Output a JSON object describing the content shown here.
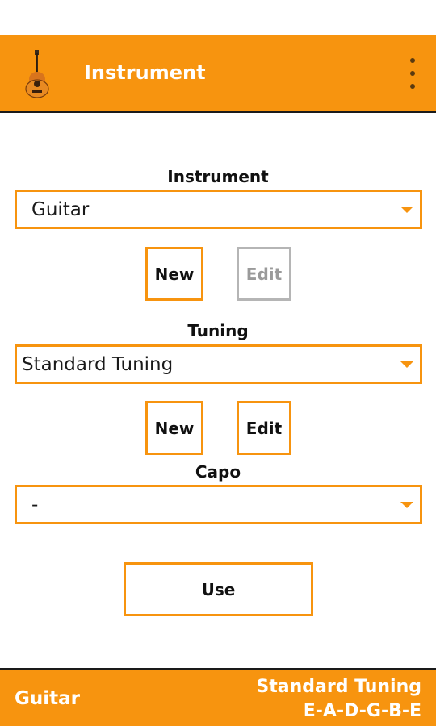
{
  "action_bar": {
    "title": "Instrument",
    "app_icon": "guitar-icon",
    "overflow_icon": "overflow-menu-icon"
  },
  "instrument_section": {
    "label": "Instrument",
    "selected": "Guitar",
    "new_label": "New",
    "edit_label": "Edit",
    "edit_enabled": false
  },
  "tuning_section": {
    "label": "Tuning",
    "selected": "Standard Tuning",
    "new_label": "New",
    "edit_label": "Edit",
    "edit_enabled": true
  },
  "capo_section": {
    "label": "Capo",
    "selected": "-"
  },
  "use_button_label": "Use",
  "bottom_bar": {
    "instrument": "Guitar",
    "tuning_name": "Standard Tuning",
    "tuning_notes": "E-A-D-G-B-E"
  },
  "colors": {
    "accent": "#f7940f",
    "disabled": "#b5b5b5"
  }
}
